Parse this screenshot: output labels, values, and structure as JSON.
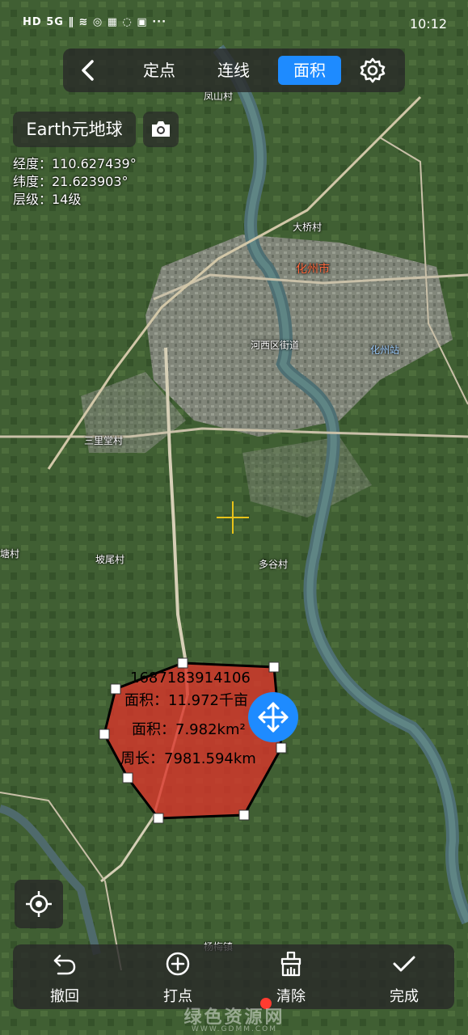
{
  "status_bar": {
    "left": "HD 5G ∥ ≋ ◎ ▦ ◌ ▣ ···",
    "time": "10:12"
  },
  "nav": {
    "tabs": [
      {
        "label": "定点",
        "active": false
      },
      {
        "label": "连线",
        "active": false
      },
      {
        "label": "面积",
        "active": true
      }
    ]
  },
  "app": {
    "brand": "Earth元地球"
  },
  "coords": {
    "longitude": "经度：110.627439°",
    "latitude": "纬度：21.623903°",
    "level": "层级：14级"
  },
  "places": [
    {
      "name": "凤山村"
    },
    {
      "name": "大桥村"
    },
    {
      "name": "化州市"
    },
    {
      "name": "河西区街道"
    },
    {
      "name": "化州站"
    },
    {
      "name": "三里堂村"
    },
    {
      "name": "多谷村"
    },
    {
      "name": "坡尾村"
    },
    {
      "name": "塘村"
    },
    {
      "name": "杨梅镇"
    }
  ],
  "polygon": {
    "id": "1687183914106",
    "area_mu": "面积：11.972千亩",
    "area_km": "面积：7.982km²",
    "perimeter": "周长：7981.594km",
    "fill_color": "#d9342b"
  },
  "toolbar": {
    "undo": "撤回",
    "add_point": "打点",
    "clear": "清除",
    "done": "完成"
  },
  "watermark": {
    "text": "绿色资源网",
    "url": "WWW.GDMM.COM"
  },
  "colors": {
    "accent": "#1e8bff",
    "polygon": "#d9342b"
  }
}
